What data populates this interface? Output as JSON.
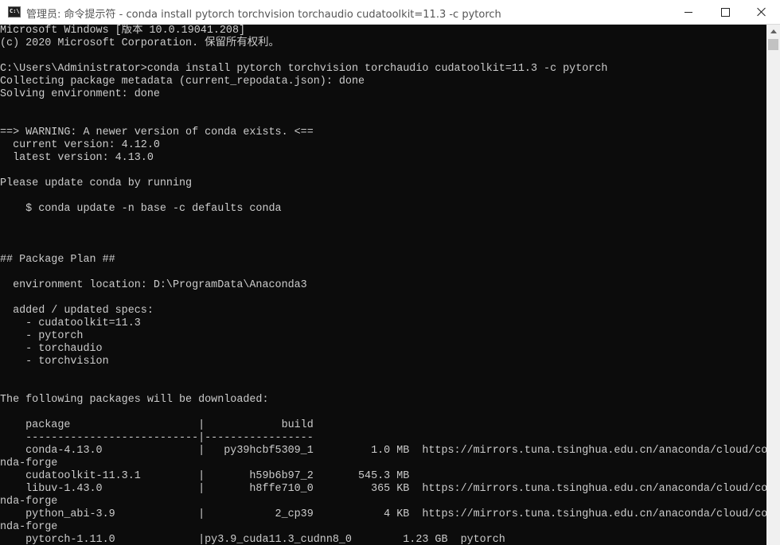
{
  "window": {
    "title": "管理员: 命令提示符 - conda  install pytorch torchvision torchaudio cudatoolkit=11.3 -c pytorch",
    "icon": "cmd-icon",
    "icon_text": "C:\\."
  },
  "console": {
    "lines": [
      "Microsoft Windows [版本 10.0.19041.208]",
      "(c) 2020 Microsoft Corporation. 保留所有权利。",
      "",
      "C:\\Users\\Administrator>conda install pytorch torchvision torchaudio cudatoolkit=11.3 -c pytorch",
      "Collecting package metadata (current_repodata.json): done",
      "Solving environment: done",
      "",
      "",
      "==> WARNING: A newer version of conda exists. <==",
      "  current version: 4.12.0",
      "  latest version: 4.13.0",
      "",
      "Please update conda by running",
      "",
      "    $ conda update -n base -c defaults conda",
      "",
      "",
      "",
      "## Package Plan ##",
      "",
      "  environment location: D:\\ProgramData\\Anaconda3",
      "",
      "  added / updated specs:",
      "    - cudatoolkit=11.3",
      "    - pytorch",
      "    - torchaudio",
      "    - torchvision",
      "",
      "",
      "The following packages will be downloaded:",
      "",
      "    package                    |            build",
      "    ---------------------------|-----------------",
      "    conda-4.13.0               |   py39hcbf5309_1         1.0 MB  https://mirrors.tuna.tsinghua.edu.cn/anaconda/cloud/co",
      "nda-forge",
      "    cudatoolkit-11.3.1         |       h59b6b97_2       545.3 MB",
      "    libuv-1.43.0               |       h8ffe710_0         365 KB  https://mirrors.tuna.tsinghua.edu.cn/anaconda/cloud/co",
      "nda-forge",
      "    python_abi-3.9             |           2_cp39           4 KB  https://mirrors.tuna.tsinghua.edu.cn/anaconda/cloud/co",
      "nda-forge",
      "    pytorch-1.11.0             |py3.9_cuda11.3_cudnn8_0        1.23 GB  pytorch"
    ]
  },
  "colors": {
    "console_bg": "#0c0c0c",
    "console_fg": "#cccccc",
    "titlebar_bg": "#ffffff"
  }
}
